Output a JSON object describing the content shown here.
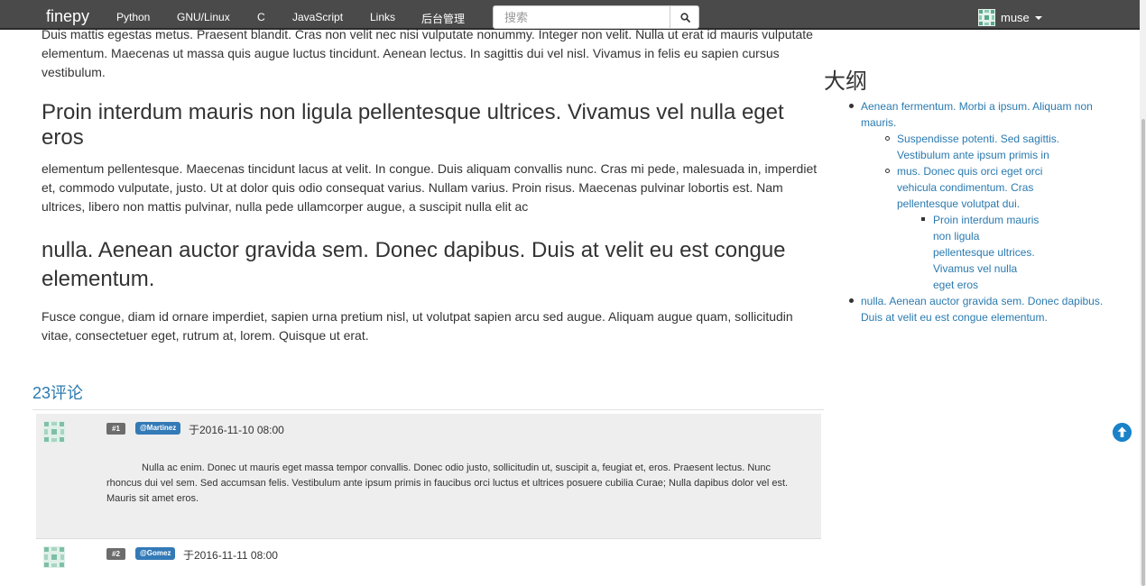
{
  "nav": {
    "brand": "finepy",
    "items": [
      "Python",
      "GNU/Linux",
      "C",
      "JavaScript",
      "Links",
      "后台管理"
    ],
    "search_placeholder": "搜索",
    "user": "muse"
  },
  "article": {
    "para_top": "Duis mattis egestas metus. Praesent blandit. Cras non velit nec nisi vulputate nonummy. Integer non velit. Nulla ut erat id mauris vulputate elementum. Maecenas ut massa quis augue luctus tincidunt. Aenean lectus. In sagittis dui vel nisl. Vivamus in felis eu sapien cursus vestibulum.",
    "heading_1": "Proin interdum mauris non ligula pellentesque ultrices. Vivamus vel nulla eget eros",
    "para_2": "elementum pellentesque. Maecenas tincidunt lacus at velit. In congue. Duis aliquam convallis nunc. Cras mi pede, malesuada in, imperdiet et, commodo vulputate, justo. Ut at dolor quis odio consequat varius. Nullam varius. Proin risus. Maecenas pulvinar lobortis est. Nam ultrices, libero non mattis pulvinar, nulla pede ullamcorper augue, a suscipit nulla elit ac",
    "heading_2": "nulla. Aenean auctor gravida sem. Donec dapibus. Duis at velit eu est congue elementum.",
    "para_3": "Fusce congue, diam id ornare imperdiet, sapien urna pretium nisl, ut volutpat sapien arcu sed augue. Aliquam augue quam, sollicitudin vitae, consectetuer eget, rutrum at, lorem. Quisque ut erat."
  },
  "outline": {
    "title": "大纲",
    "items": [
      "Aenean fermentum. Morbi a ipsum. Aliquam non mauris.",
      "Suspendisse potenti. Sed sagittis. Vestibulum ante ipsum primis in",
      "mus. Donec quis orci eget orci vehicula condimentum. Cras pellentesque volutpat dui.",
      "Proin interdum mauris non ligula pellentesque ultrices. Vivamus vel nulla eget eros",
      "nulla. Aenean auctor gravida sem. Donec dapibus. Duis at velit eu est congue elementum."
    ]
  },
  "comments": {
    "count_label": "23评论",
    "list": [
      {
        "num": "#1",
        "user": "@Martinez",
        "date": "于2016-11-10 08:00",
        "body": "Nulla ac enim. Donec ut mauris eget massa tempor convallis. Donec odio justo, sollicitudin ut, suscipit a, feugiat et, eros. Praesent lectus. Nunc rhoncus dui vel sem. Sed accumsan felis. Vestibulum ante ipsum primis in faucibus orci luctus et ultrices posuere cubilia Curae; Nulla dapibus dolor vel est. Mauris sit amet eros."
      },
      {
        "num": "#2",
        "user": "@Gomez",
        "date": "于2016-11-11 08:00"
      }
    ]
  },
  "colors": {
    "navbar": "#4a4a4a",
    "link": "#2a7ab0",
    "user_badge": "#337ab7",
    "back_to_top": "#1a82c8"
  }
}
